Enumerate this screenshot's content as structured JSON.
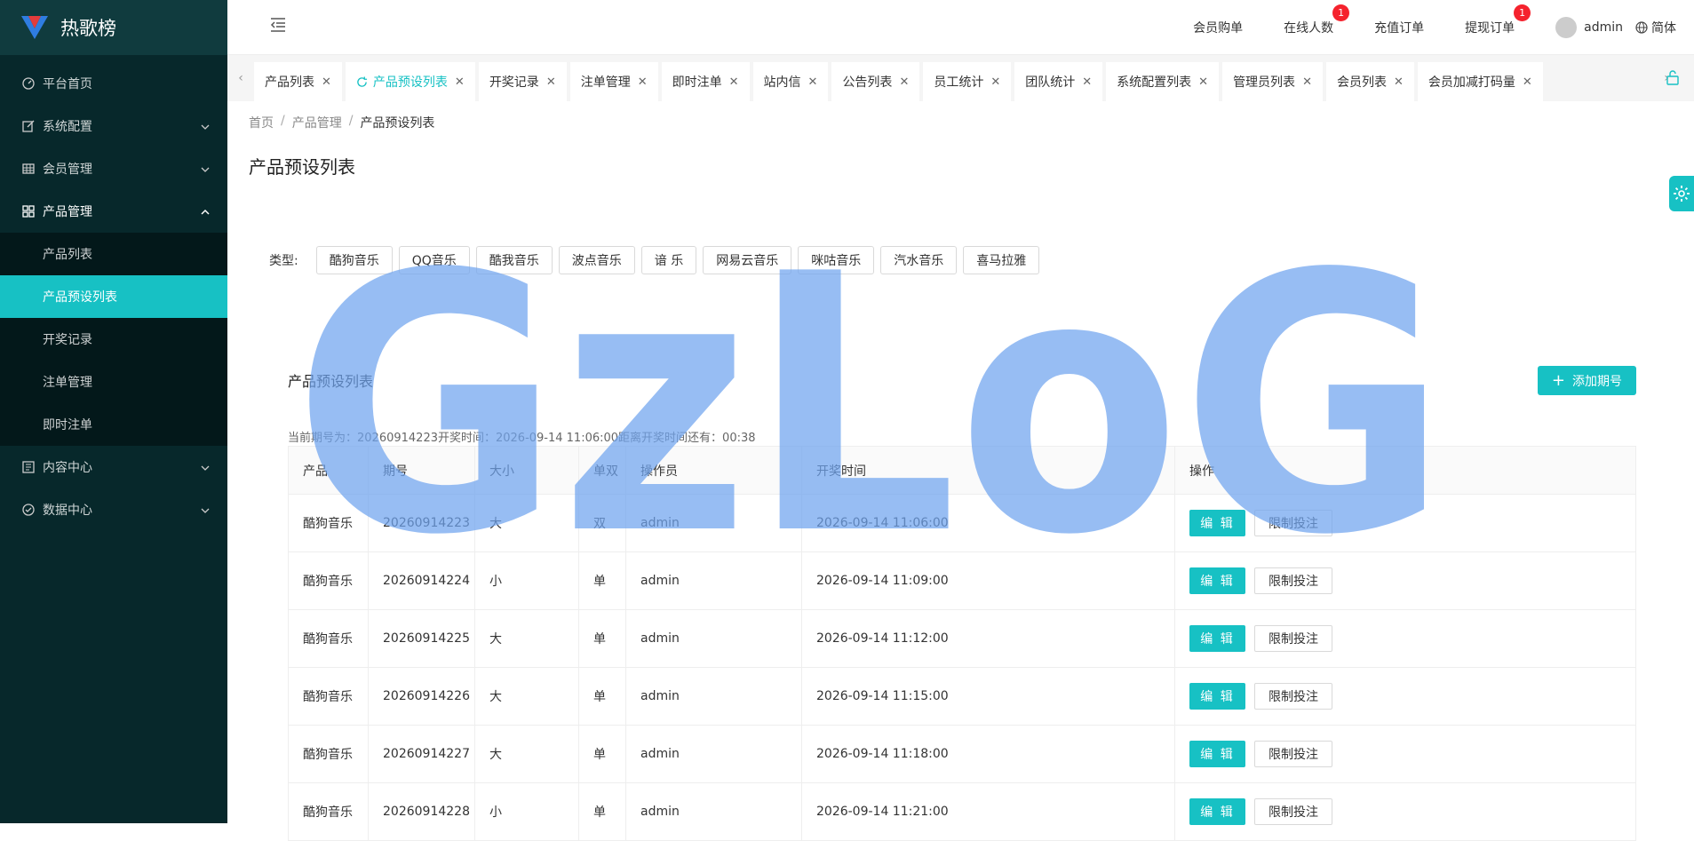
{
  "app": {
    "title": "热歌榜"
  },
  "sidebar": {
    "items": [
      {
        "label": "平台首页",
        "icon": "dashboard-icon",
        "has_children": false
      },
      {
        "label": "系统配置",
        "icon": "edit-icon",
        "has_children": true
      },
      {
        "label": "会员管理",
        "icon": "table-icon",
        "has_children": true
      },
      {
        "label": "产品管理",
        "icon": "grid-icon",
        "has_children": true,
        "open": true
      },
      {
        "label": "内容中心",
        "icon": "content-icon",
        "has_children": true
      },
      {
        "label": "数据中心",
        "icon": "check-circle-icon",
        "has_children": true
      }
    ],
    "sub_items": [
      "产品列表",
      "产品预设列表",
      "开奖记录",
      "注单管理",
      "即时注单"
    ],
    "active_sub": "产品预设列表"
  },
  "header": {
    "nav": [
      {
        "label": "会员购单"
      },
      {
        "label": "在线人数",
        "badge": "1"
      },
      {
        "label": "充值订单"
      },
      {
        "label": "提现订单",
        "badge": "1"
      }
    ],
    "user": "admin",
    "lang": "简体"
  },
  "tabs": [
    {
      "label": "产品列表"
    },
    {
      "label": "产品预设列表",
      "active": true
    },
    {
      "label": "开奖记录"
    },
    {
      "label": "注单管理"
    },
    {
      "label": "即时注单"
    },
    {
      "label": "站内信"
    },
    {
      "label": "公告列表"
    },
    {
      "label": "员工统计"
    },
    {
      "label": "团队统计"
    },
    {
      "label": "系统配置列表"
    },
    {
      "label": "管理员列表"
    },
    {
      "label": "会员列表"
    },
    {
      "label": "会员加减打码量"
    }
  ],
  "breadcrumb": [
    "首页",
    "产品管理",
    "产品预设列表"
  ],
  "page_title": "产品预设列表",
  "filter": {
    "label": "类型:",
    "options": [
      "酷狗音乐",
      "QQ音乐",
      "酷我音乐",
      "波点音乐",
      "谙 乐",
      "网易云音乐",
      "咪咕音乐",
      "汽水音乐",
      "喜马拉雅"
    ]
  },
  "table": {
    "title": "产品预设列表",
    "add_label": "添加期号",
    "period_info": "当前期号为：20260914223开奖时间：2026-09-14 11:06:00距离开奖时间还有：00:38",
    "columns": [
      "产品",
      "期号",
      "大小",
      "单双",
      "操作员",
      "开奖时间",
      "操作"
    ],
    "rows": [
      [
        "酷狗音乐",
        "20260914223",
        "大",
        "双",
        "admin",
        "2026-09-14 11:06:00"
      ],
      [
        "酷狗音乐",
        "20260914224",
        "小",
        "单",
        "admin",
        "2026-09-14 11:09:00"
      ],
      [
        "酷狗音乐",
        "20260914225",
        "大",
        "单",
        "admin",
        "2026-09-14 11:12:00"
      ],
      [
        "酷狗音乐",
        "20260914226",
        "大",
        "单",
        "admin",
        "2026-09-14 11:15:00"
      ],
      [
        "酷狗音乐",
        "20260914227",
        "大",
        "单",
        "admin",
        "2026-09-14 11:18:00"
      ],
      [
        "酷狗音乐",
        "20260914228",
        "小",
        "单",
        "admin",
        "2026-09-14 11:21:00"
      ]
    ],
    "edit_label": "编 辑",
    "limit_label": "限制投注"
  },
  "watermark": "GzLoG",
  "colors": {
    "accent": "#17c1c4",
    "sidebar": "#07282b",
    "badge": "#f5222d",
    "watermark": "#6fa4ee"
  }
}
